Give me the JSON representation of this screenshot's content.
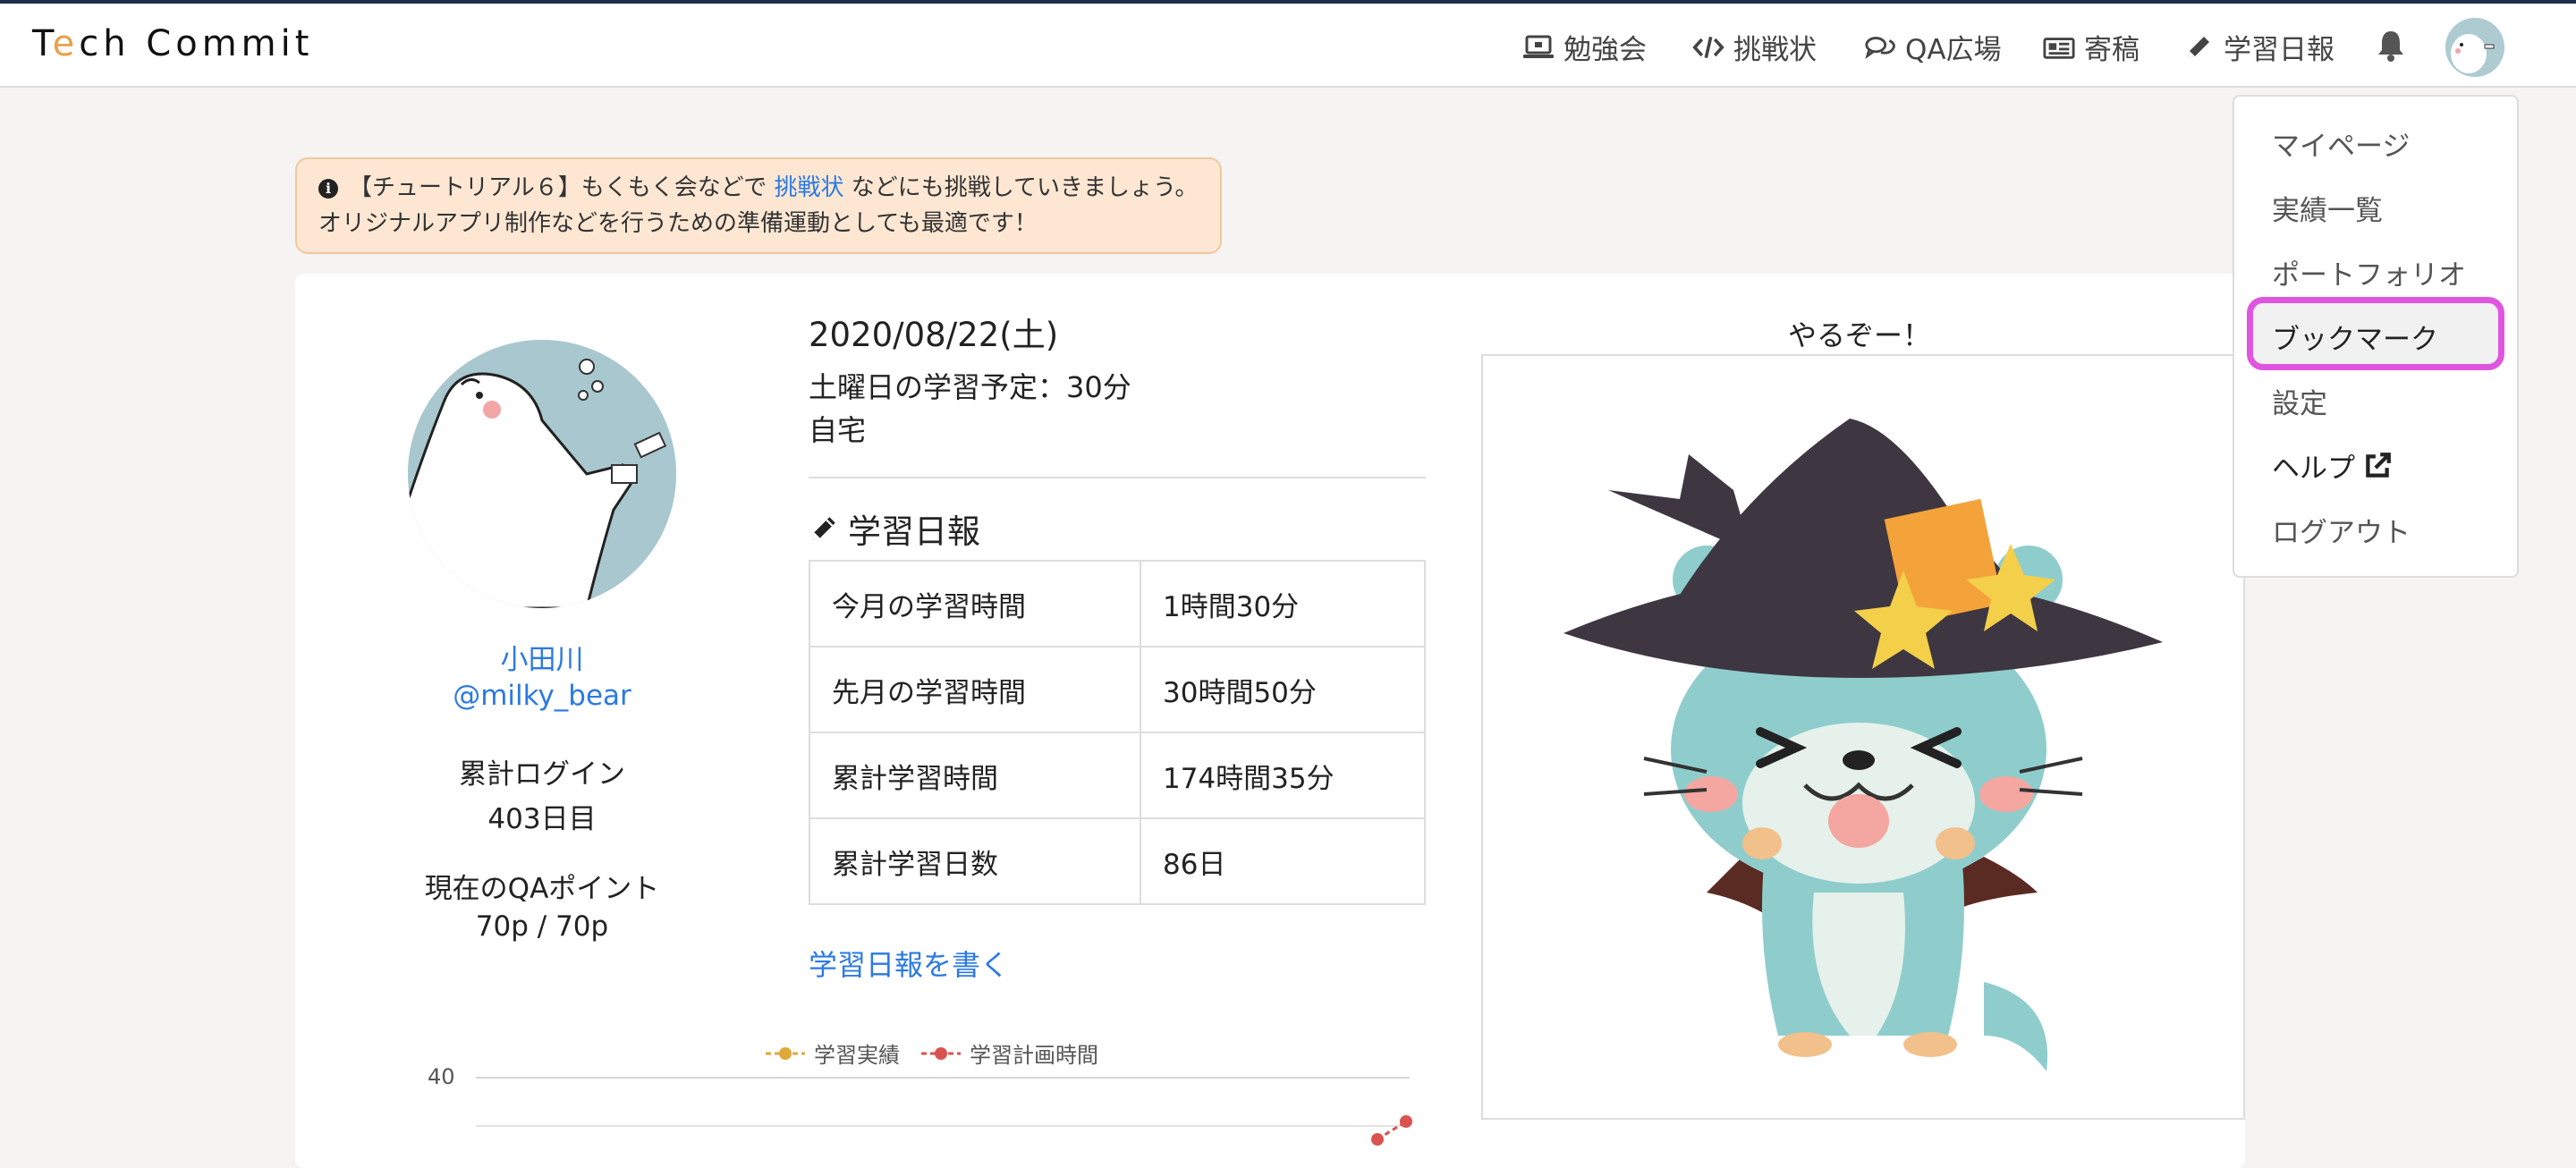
{
  "brand": {
    "logo_prefix": "T",
    "logo_e": "e",
    "logo_rest": "ch Commit"
  },
  "nav": {
    "study_group": "勉強会",
    "challenge": "挑戦状",
    "qa_plaza": "QA広場",
    "contribution": "寄稿",
    "study_report": "学習日報"
  },
  "alert": {
    "text_before_link": "【チュートリアル６】もくもく会などで ",
    "link_text": "挑戦状",
    "text_after_link": " などにも挑戦していきましょう。",
    "line2": "オリジナルアプリ制作などを行うための準備運動としても最適です！"
  },
  "profile": {
    "name": "小田川",
    "handle": "@milky_bear",
    "login_label": "累計ログイン",
    "login_value": "403日目",
    "qa_label": "現在のQAポイント",
    "qa_value": "70p / 70p"
  },
  "report": {
    "date": "2020/08/22(土)",
    "plan": "土曜日の学習予定：30分",
    "place": "自宅",
    "section_title": "学習日報",
    "rows": [
      {
        "label": "今月の学習時間",
        "value": "1時間30分"
      },
      {
        "label": "先月の学習時間",
        "value": "30時間50分"
      },
      {
        "label": "累計学習時間",
        "value": "174時間35分"
      },
      {
        "label": "累計学習日数",
        "value": "86日"
      }
    ],
    "write_link": "学習日報を書く"
  },
  "chart": {
    "legend_actual": "学習実績",
    "legend_plan": "学習計画時間",
    "y_tick_top": "40",
    "colors": {
      "actual": "#e0a83a",
      "plan": "#d9534f"
    }
  },
  "motto": {
    "caption": "やるぞー！"
  },
  "dropdown": {
    "items": [
      "マイページ",
      "実績一覧",
      "ポートフォリオ",
      "ブックマーク",
      "設定",
      "ヘルプ",
      "ログアウト"
    ]
  },
  "colors": {
    "link": "#2a7ae2",
    "highlight": "#e055e0",
    "alert_bg": "#fde7d3"
  }
}
